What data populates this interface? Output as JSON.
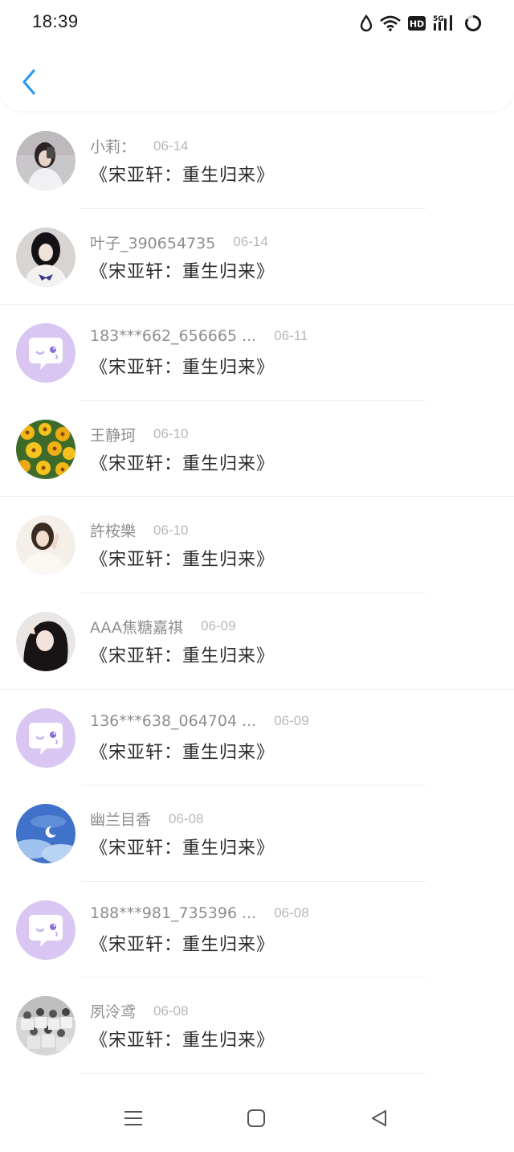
{
  "status_bar": {
    "time": "18:39",
    "icons": [
      "drop-icon",
      "wifi-icon",
      "hd-icon",
      "5g-signal-icon",
      "battery-ring-icon"
    ],
    "signal_label": "5G",
    "hd_label": "HD"
  },
  "header": {
    "back_icon": "chevron-left-icon",
    "accent_color": "#2b9af3"
  },
  "list": [
    {
      "name": "小莉：",
      "date": "06-14",
      "title": "《宋亚轩：重生归来》",
      "avatar": "photo-girl-white-shirt"
    },
    {
      "name": "叶子_390654735",
      "date": "06-14",
      "title": "《宋亚轩：重生归来》",
      "avatar": "photo-girl-butterfly-tee"
    },
    {
      "name": "183***662_656665 ...",
      "date": "06-11",
      "title": "《宋亚轩：重生归来》",
      "avatar": "default-chat-avatar"
    },
    {
      "name": "王静珂",
      "date": "06-10",
      "title": "《宋亚轩：重生归来》",
      "avatar": "photo-yellow-flowers"
    },
    {
      "name": "許桉樂",
      "date": "06-10",
      "title": "《宋亚轩：重生归来》",
      "avatar": "photo-girl-white-sweater"
    },
    {
      "name": "AAA焦糖嘉祺",
      "date": "06-09",
      "title": "《宋亚轩：重生归来》",
      "avatar": "photo-girl-dark-hair"
    },
    {
      "name": "136***638_064704 ...",
      "date": "06-09",
      "title": "《宋亚轩：重生归来》",
      "avatar": "default-chat-avatar"
    },
    {
      "name": "幽兰目香",
      "date": "06-08",
      "title": "《宋亚轩：重生归来》",
      "avatar": "photo-blue-sky-moon"
    },
    {
      "name": "188***981_735396 ...",
      "date": "06-08",
      "title": "《宋亚轩：重生归来》",
      "avatar": "default-chat-avatar"
    },
    {
      "name": "夙泠鸢",
      "date": "06-08",
      "title": "《宋亚轩：重生归来》",
      "avatar": "photo-group-bw"
    }
  ],
  "navbar": {
    "icons": [
      "menu-icon",
      "home-square-icon",
      "back-triangle-icon"
    ]
  }
}
